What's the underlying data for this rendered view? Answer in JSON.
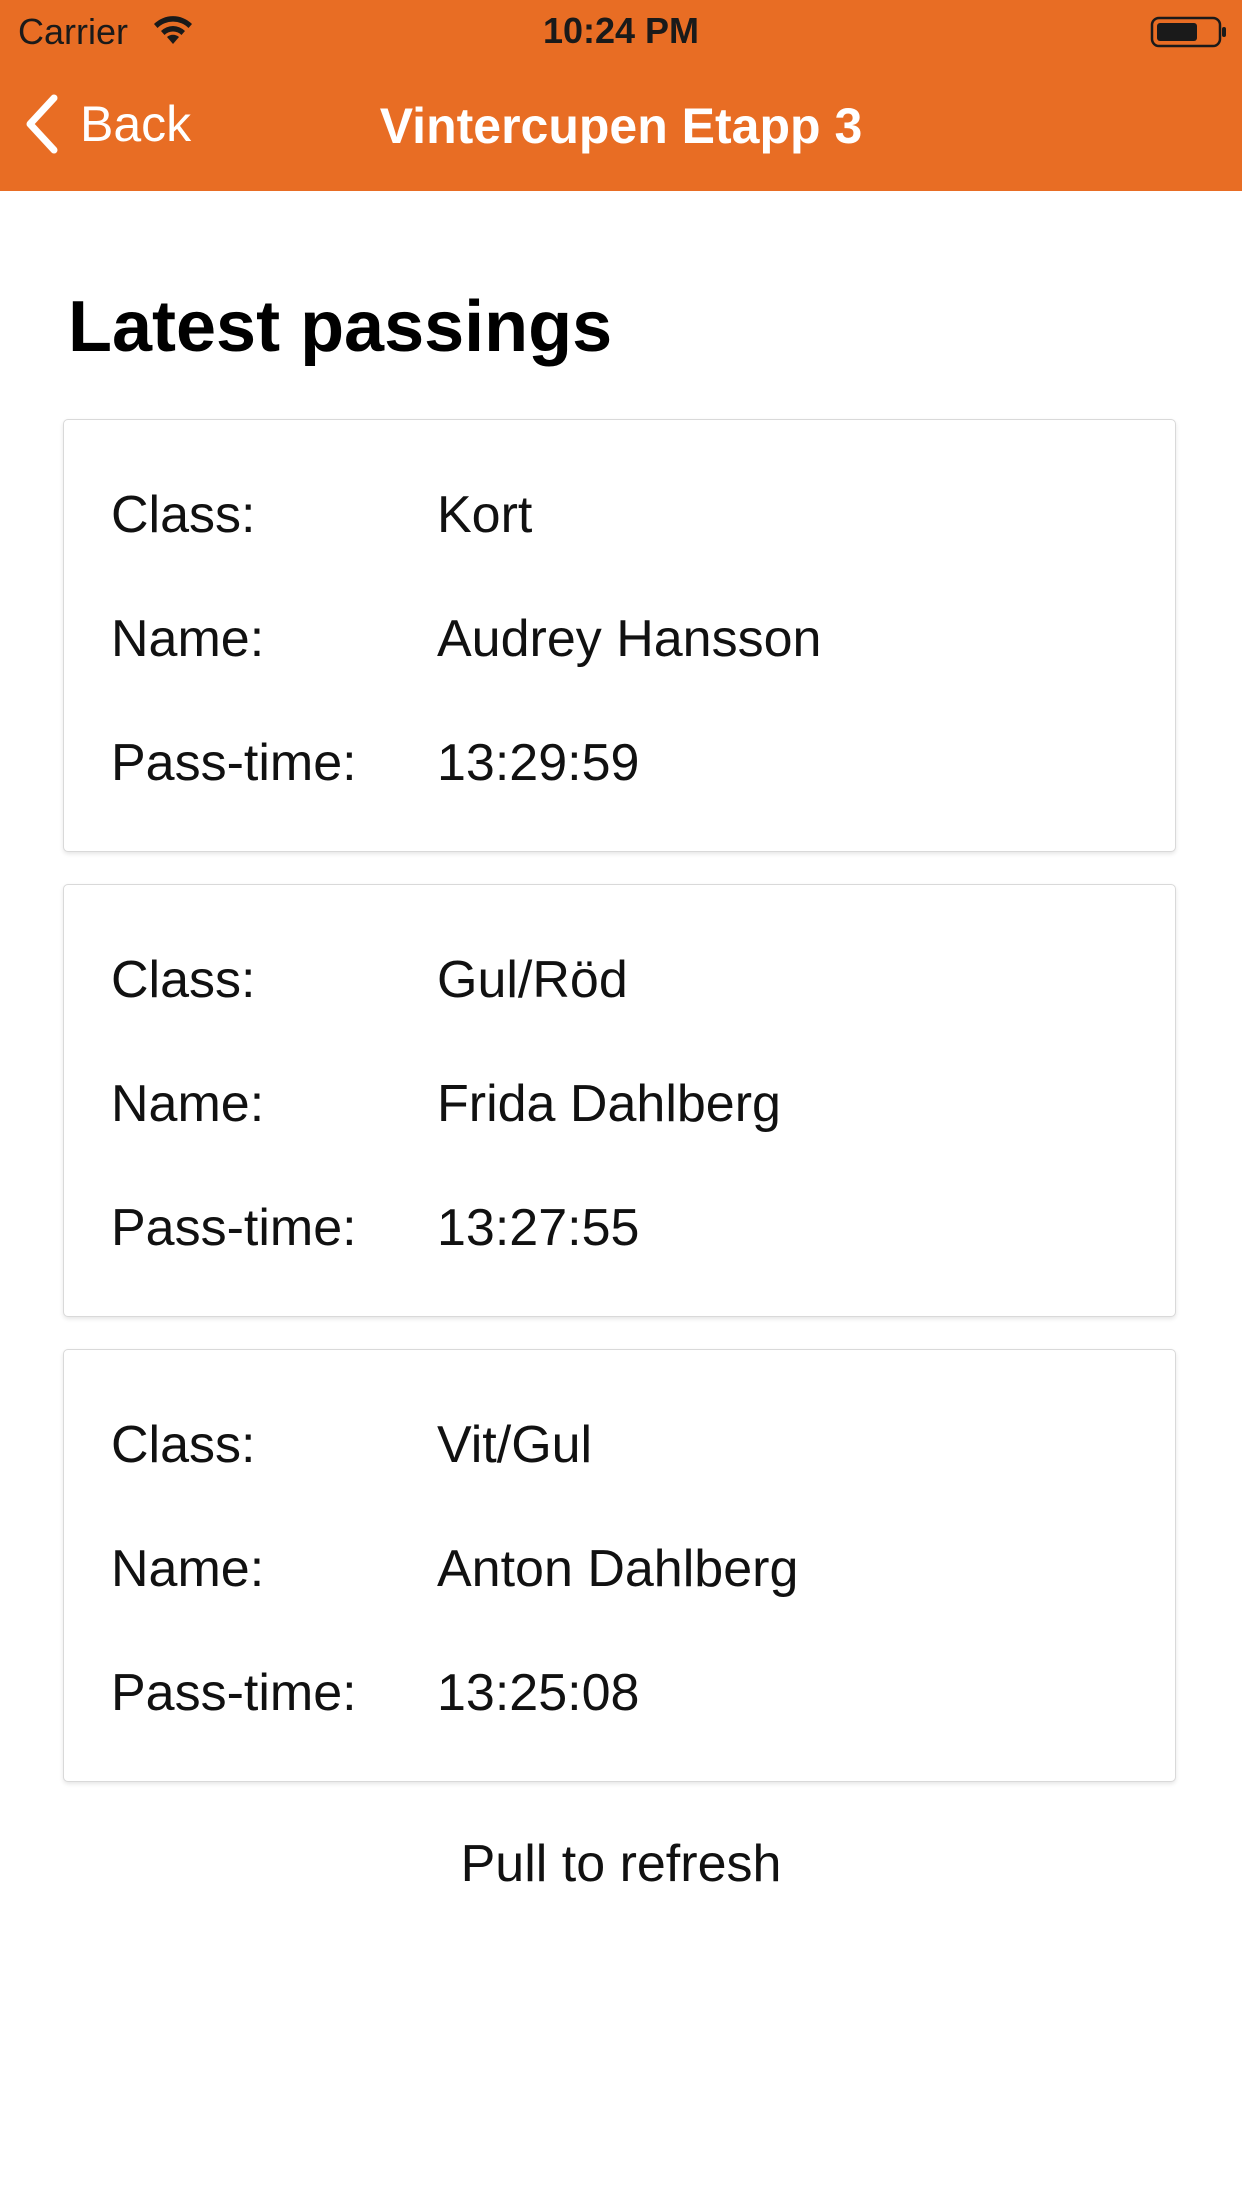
{
  "status_bar": {
    "carrier": "Carrier",
    "time": "10:24 PM"
  },
  "nav": {
    "back_label": "Back",
    "title": "Vintercupen Etapp 3"
  },
  "page": {
    "title": "Latest passings",
    "refresh_hint": "Pull to refresh"
  },
  "labels": {
    "class": "Class:",
    "name": "Name:",
    "pass_time": "Pass-time:"
  },
  "passings": [
    {
      "class": "Kort",
      "name": "Audrey Hansson",
      "pass_time": "13:29:59"
    },
    {
      "class": "Gul/Röd",
      "name": "Frida Dahlberg",
      "pass_time": "13:27:55"
    },
    {
      "class": "Vit/Gul",
      "name": "Anton Dahlberg",
      "pass_time": "13:25:08"
    }
  ],
  "colors": {
    "header": "#E86D24",
    "header_text": "#FFFFFF",
    "card_border": "#D9D9D9"
  },
  "icons": {
    "wifi": "wifi-icon",
    "battery": "battery-icon",
    "back": "chevron-left-icon"
  }
}
